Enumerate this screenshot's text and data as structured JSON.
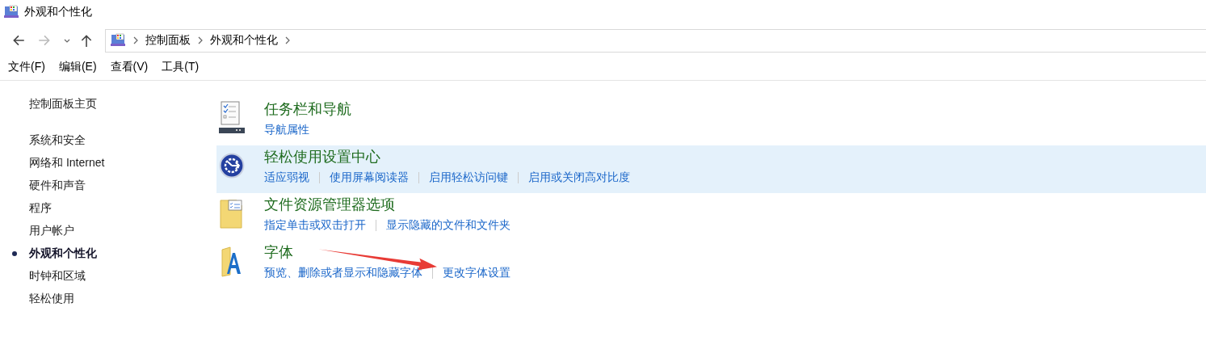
{
  "window": {
    "title": "外观和个性化"
  },
  "address_bar": {
    "crumbs": [
      "控制面板",
      "外观和个性化"
    ]
  },
  "menu": [
    "文件(F)",
    "编辑(E)",
    "查看(V)",
    "工具(T)"
  ],
  "sidebar": {
    "home": "控制面板主页",
    "items": [
      {
        "label": "系统和安全",
        "selected": false
      },
      {
        "label": "网络和 Internet",
        "selected": false
      },
      {
        "label": "硬件和声音",
        "selected": false
      },
      {
        "label": "程序",
        "selected": false
      },
      {
        "label": "用户帐户",
        "selected": false
      },
      {
        "label": "外观和个性化",
        "selected": true
      },
      {
        "label": "时钟和区域",
        "selected": false
      },
      {
        "label": "轻松使用",
        "selected": false
      }
    ]
  },
  "categories": [
    {
      "kind": "taskbar",
      "title": "任务栏和导航",
      "highlighted": false,
      "links": [
        "导航属性"
      ]
    },
    {
      "kind": "ease",
      "title": "轻松使用设置中心",
      "highlighted": true,
      "links": [
        "适应弱视",
        "使用屏幕阅读器",
        "启用轻松访问键",
        "启用或关闭高对比度"
      ]
    },
    {
      "kind": "folder",
      "title": "文件资源管理器选项",
      "highlighted": false,
      "links": [
        "指定单击或双击打开",
        "显示隐藏的文件和文件夹"
      ]
    },
    {
      "kind": "fonts",
      "title": "字体",
      "highlighted": false,
      "links": [
        "预览、删除或者显示和隐藏字体",
        "更改字体设置"
      ]
    }
  ],
  "annotation": {
    "kind": "arrow"
  }
}
